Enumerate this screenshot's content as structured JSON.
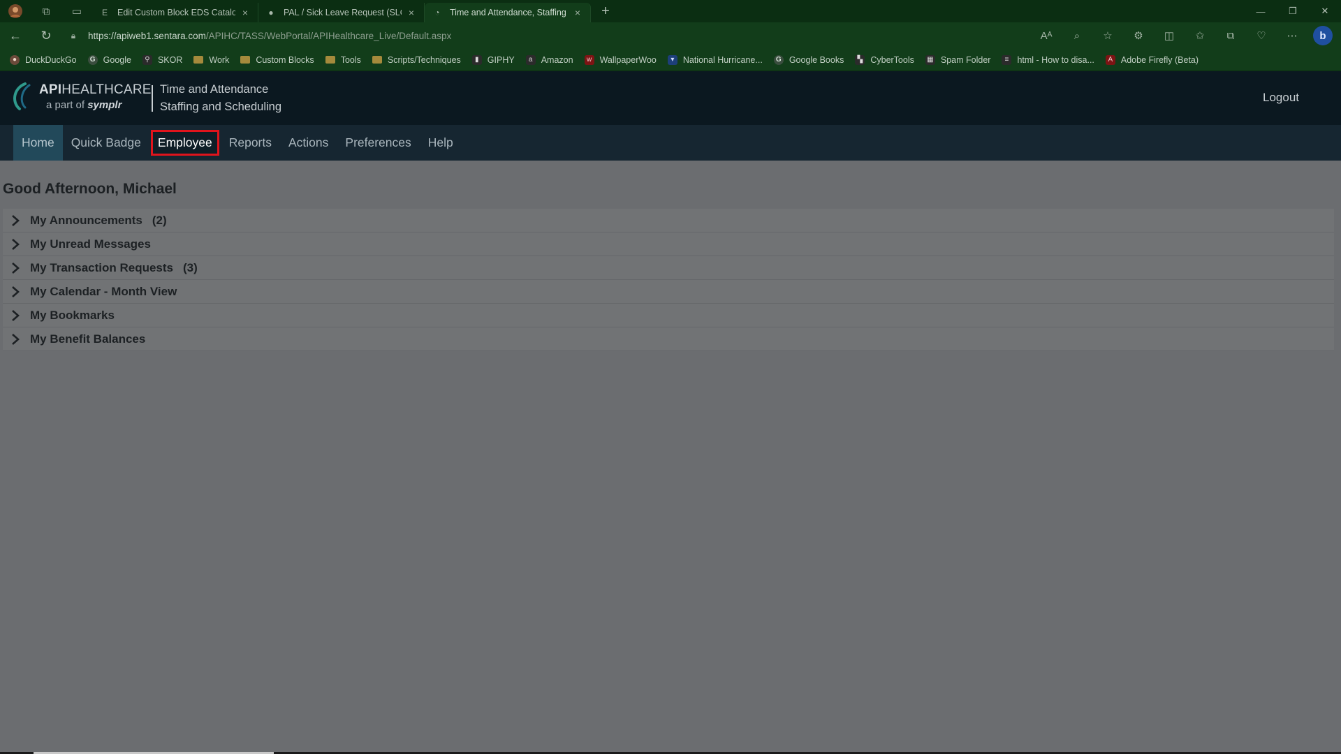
{
  "browser": {
    "tabs": [
      {
        "favicon": "E",
        "title": "Edit Custom Block EDS Catalog U",
        "active": false
      },
      {
        "favicon": "●",
        "title": "PAL / Sick Leave Request (SLOTH",
        "active": false
      },
      {
        "favicon": "◔",
        "title": "Time and Attendance, Staffing ar",
        "active": true
      }
    ],
    "url_host": "https://apiweb1.sentara.com",
    "url_path": "/APIHC/TASS/WebPortal/APIHealthcare_Live/Default.aspx",
    "profile_initial": "b",
    "bookmarks": [
      {
        "label": "DuckDuckGo",
        "icon": "duck-icon"
      },
      {
        "label": "Google",
        "icon": "google-icon"
      },
      {
        "label": "SKOR",
        "icon": "skor-icon"
      },
      {
        "label": "Work",
        "icon": "folder-icon"
      },
      {
        "label": "Custom Blocks",
        "icon": "folder-icon"
      },
      {
        "label": "Tools",
        "icon": "folder-icon"
      },
      {
        "label": "Scripts/Techniques",
        "icon": "folder-icon"
      },
      {
        "label": "GIPHY",
        "icon": "giphy-icon"
      },
      {
        "label": "Amazon",
        "icon": "amazon-icon"
      },
      {
        "label": "WallpaperWoo",
        "icon": "wallpaper-icon"
      },
      {
        "label": "National Hurricane...",
        "icon": "noaa-icon"
      },
      {
        "label": "Google Books",
        "icon": "google-icon"
      },
      {
        "label": "CyberTools",
        "icon": "cybertools-icon"
      },
      {
        "label": "Spam Folder",
        "icon": "spam-icon"
      },
      {
        "label": "html - How to disa...",
        "icon": "stackoverflow-icon"
      },
      {
        "label": "Adobe Firefly (Beta)",
        "icon": "adobe-icon"
      }
    ]
  },
  "header": {
    "logo_brand_bold": "API",
    "logo_brand_rest": "HEALTHCARE",
    "logo_sub_prefix": "a part of",
    "logo_sub_brand": "symplr",
    "title_line1": "Time and Attendance",
    "title_line2": "Staffing and Scheduling",
    "logout_label": "Logout"
  },
  "menu": {
    "home": "Home",
    "quick_badge": "Quick Badge",
    "employee": "Employee",
    "reports": "Reports",
    "actions": "Actions",
    "preferences": "Preferences",
    "help": "Help"
  },
  "main": {
    "greeting": "Good Afternoon, Michael",
    "panels": [
      {
        "title": "My Announcements",
        "count": "(2)"
      },
      {
        "title": "My Unread Messages",
        "count": ""
      },
      {
        "title": "My Transaction Requests",
        "count": "(3)"
      },
      {
        "title": "My Calendar - Month View",
        "count": ""
      },
      {
        "title": "My Bookmarks",
        "count": ""
      },
      {
        "title": "My Benefit Balances",
        "count": ""
      }
    ]
  },
  "colors": {
    "highlight_border": "#e0141c",
    "browser_chrome": "#123d1a",
    "app_header": "#0b1820"
  }
}
